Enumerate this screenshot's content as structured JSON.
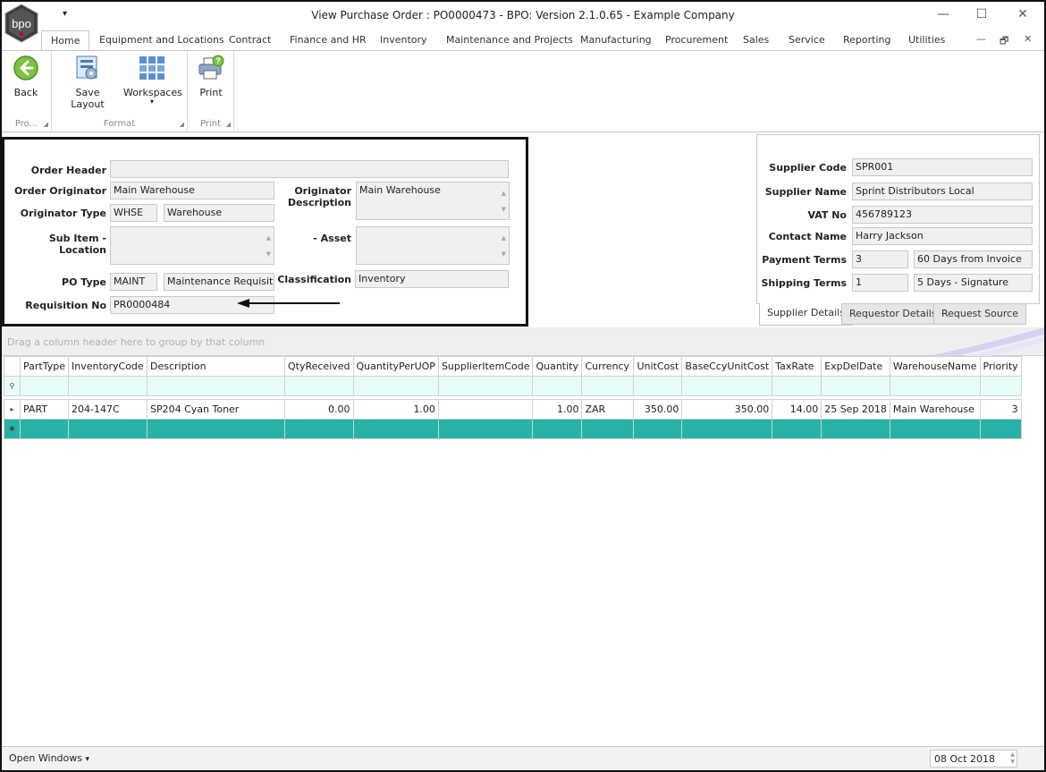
{
  "window": {
    "title": "View Purchase Order : PO0000473 - BPO: Version 2.1.0.65 - Example Company",
    "logo_text": "bpo",
    "qat_glyph": "▾",
    "minimize": "—",
    "maximize": "☐",
    "close": "✕"
  },
  "tabs": [
    {
      "label": "Home"
    },
    {
      "label": "Equipment and Locations"
    },
    {
      "label": "Contract"
    },
    {
      "label": "Finance and HR"
    },
    {
      "label": "Inventory"
    },
    {
      "label": "Maintenance and Projects"
    },
    {
      "label": "Manufacturing"
    },
    {
      "label": "Procurement"
    },
    {
      "label": "Sales"
    },
    {
      "label": "Service"
    },
    {
      "label": "Reporting"
    },
    {
      "label": "Utilities"
    }
  ],
  "mdi_controls": {
    "minimize": "—",
    "restore": "🗗",
    "close": "✕"
  },
  "ribbon": {
    "groups": [
      {
        "label": "Pro...",
        "buttons": [
          {
            "label": "Back",
            "icon": "back-arrow-icon"
          }
        ]
      },
      {
        "label": "Format",
        "buttons": [
          {
            "label": "Save Layout",
            "icon": "save-layout-icon"
          },
          {
            "label": "Workspaces",
            "icon": "workspaces-icon",
            "dropdown": "▾"
          }
        ]
      },
      {
        "label": "Print",
        "buttons": [
          {
            "label": "Print",
            "icon": "printer-icon"
          }
        ]
      }
    ]
  },
  "order": {
    "order_header_label": "Order Header",
    "order_header_value": "",
    "order_originator_label": "Order Originator",
    "order_originator_value": "Main Warehouse",
    "originator_description_label": "Originator Description",
    "originator_description_value": "Main Warehouse",
    "originator_type_label": "Originator Type",
    "originator_type_code": "WHSE",
    "originator_type_desc": "Warehouse",
    "sub_item_location_label": "Sub Item - Location",
    "sub_item_location_value": "",
    "asset_label": "- Asset",
    "asset_value": "",
    "po_type_label": "PO Type",
    "po_type_code": "MAINT",
    "po_type_desc": "Maintenance Requisition",
    "classification_label": "Classification",
    "classification_value": "Inventory",
    "requisition_no_label": "Requisition No",
    "requisition_no_value": "PR0000484"
  },
  "supplier": {
    "supplier_code_label": "Supplier Code",
    "supplier_code_value": "SPR001",
    "supplier_name_label": "Supplier Name",
    "supplier_name_value": "Sprint Distributors Local",
    "vat_no_label": "VAT No",
    "vat_no_value": "456789123",
    "contact_name_label": "Contact Name",
    "contact_name_value": "Harry Jackson",
    "payment_terms_label": "Payment Terms",
    "payment_terms_code": "3",
    "payment_terms_desc": "60 Days from Invoice",
    "shipping_terms_label": "Shipping Terms",
    "shipping_terms_code": "1",
    "shipping_terms_desc": "5 Days - Signature",
    "tabs": [
      {
        "label": "Supplier Details"
      },
      {
        "label": "Requestor Details"
      },
      {
        "label": "Request Source"
      }
    ]
  },
  "grid": {
    "group_hint": "Drag a column header here to group by that column",
    "columns": [
      "PartType",
      "InventoryCode",
      "Description",
      "QtyReceived",
      "QuantityPerUOP",
      "SupplierItemCode",
      "Quantity",
      "Currency",
      "UnitCost",
      "BaseCcyUnitCost",
      "TaxRate",
      "ExpDelDate",
      "WarehouseName",
      "Priority"
    ],
    "rows": [
      {
        "PartType": "PART",
        "InventoryCode": "204-147C",
        "Description": "SP204 Cyan Toner",
        "QtyReceived": "0.00",
        "QuantityPerUOP": "1.00",
        "SupplierItemCode": "",
        "Quantity": "1.00",
        "Currency": "ZAR",
        "UnitCost": "350.00",
        "BaseCcyUnitCost": "350.00",
        "TaxRate": "14.00",
        "ExpDelDate": "25 Sep 2018",
        "WarehouseName": "Main Warehouse",
        "Priority": "3"
      }
    ],
    "filter_glyph": "⚲",
    "row_glyph": "▸",
    "new_row_glyph": "✱"
  },
  "statusbar": {
    "open_windows": "Open Windows",
    "open_windows_arrow": "▾",
    "date": "08 Oct 2018"
  }
}
